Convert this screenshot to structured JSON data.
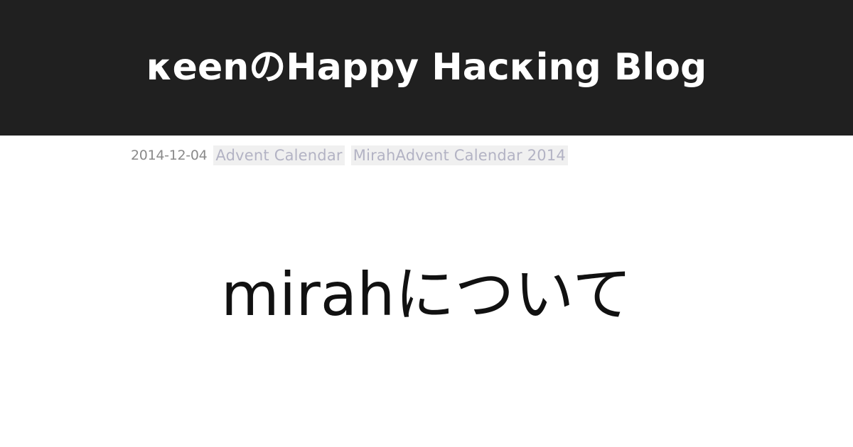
{
  "site": {
    "title": "κeenのHappy Hacκing Blog"
  },
  "post": {
    "date": "2014-12-04",
    "tags": [
      "Advent Calendar",
      "MirahAdvent Calendar 2014"
    ],
    "title": "mirahについて"
  },
  "colors": {
    "header_background": "#202020",
    "header_text": "#ffffff",
    "tag_background": "#f0f0f0",
    "tag_text": "#b3b3c4",
    "date_text": "#8a8a8a",
    "title_text": "#111111"
  }
}
